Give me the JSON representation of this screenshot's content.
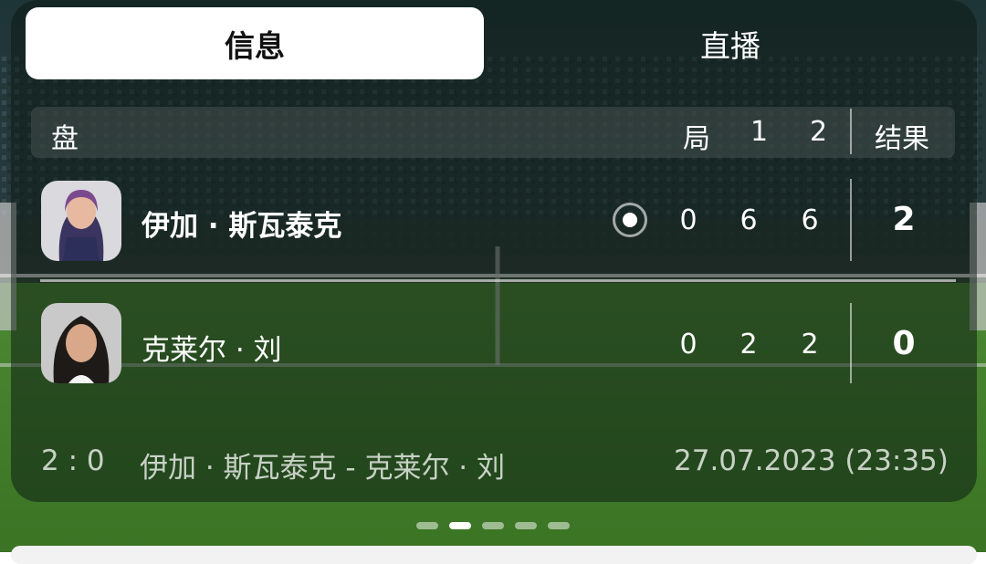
{
  "tabs": {
    "info": "信息",
    "live": "直播"
  },
  "header": {
    "set_label": "盘",
    "game_label": "局",
    "set1": "1",
    "set2": "2",
    "result_label": "结果"
  },
  "players": [
    {
      "name": "伊加 · 斯瓦泰克",
      "game": "0",
      "set1": "6",
      "set2": "6",
      "result": "2",
      "serving": true
    },
    {
      "name": "克莱尔 · 刘",
      "game": "0",
      "set1": "2",
      "set2": "2",
      "result": "0",
      "serving": false
    }
  ],
  "footer": {
    "score": "2 : 0",
    "match": "伊加 · 斯瓦泰克 - 克莱尔 · 刘",
    "datetime": "27.07.2023 (23:35)"
  },
  "pager": {
    "count": 5,
    "active_index": 1
  },
  "colors": {
    "court_green": "#3f7a28",
    "stadium_dark": "#1a2a2c",
    "accent_white": "#ffffff"
  }
}
